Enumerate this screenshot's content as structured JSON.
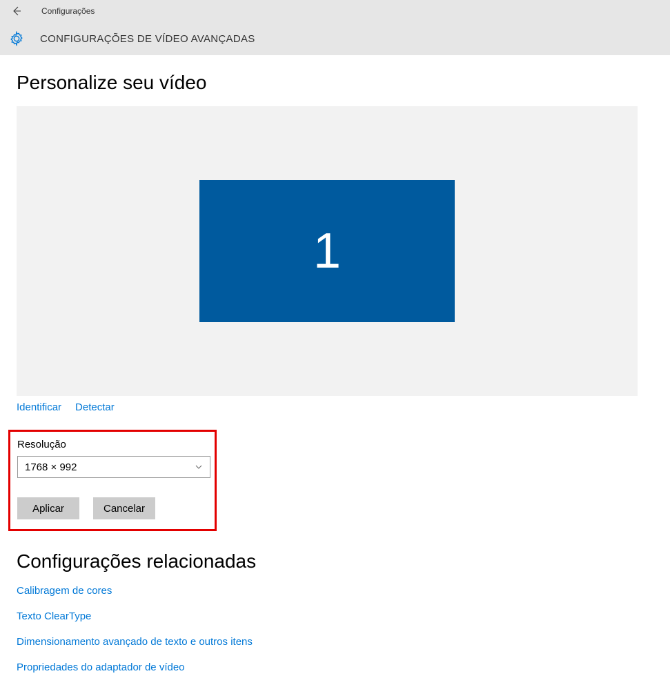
{
  "header": {
    "app_name": "Configurações",
    "page_title": "CONFIGURAÇÕES DE VÍDEO AVANÇADAS"
  },
  "main": {
    "heading": "Personalize seu vídeo",
    "monitor_number": "1",
    "identify_link": "Identificar",
    "detect_link": "Detectar",
    "resolution_label": "Resolução",
    "resolution_value": "1768 × 992",
    "apply_button": "Aplicar",
    "cancel_button": "Cancelar"
  },
  "related": {
    "heading": "Configurações relacionadas",
    "links": {
      "color_calibration": "Calibragem de cores",
      "cleartype": "Texto ClearType",
      "advanced_sizing": "Dimensionamento avançado de texto e outros itens",
      "adapter_properties": "Propriedades do adaptador de vídeo"
    }
  },
  "colors": {
    "accent": "#0078d7",
    "monitor_blue": "#005a9e",
    "highlight_red": "#e30000"
  }
}
